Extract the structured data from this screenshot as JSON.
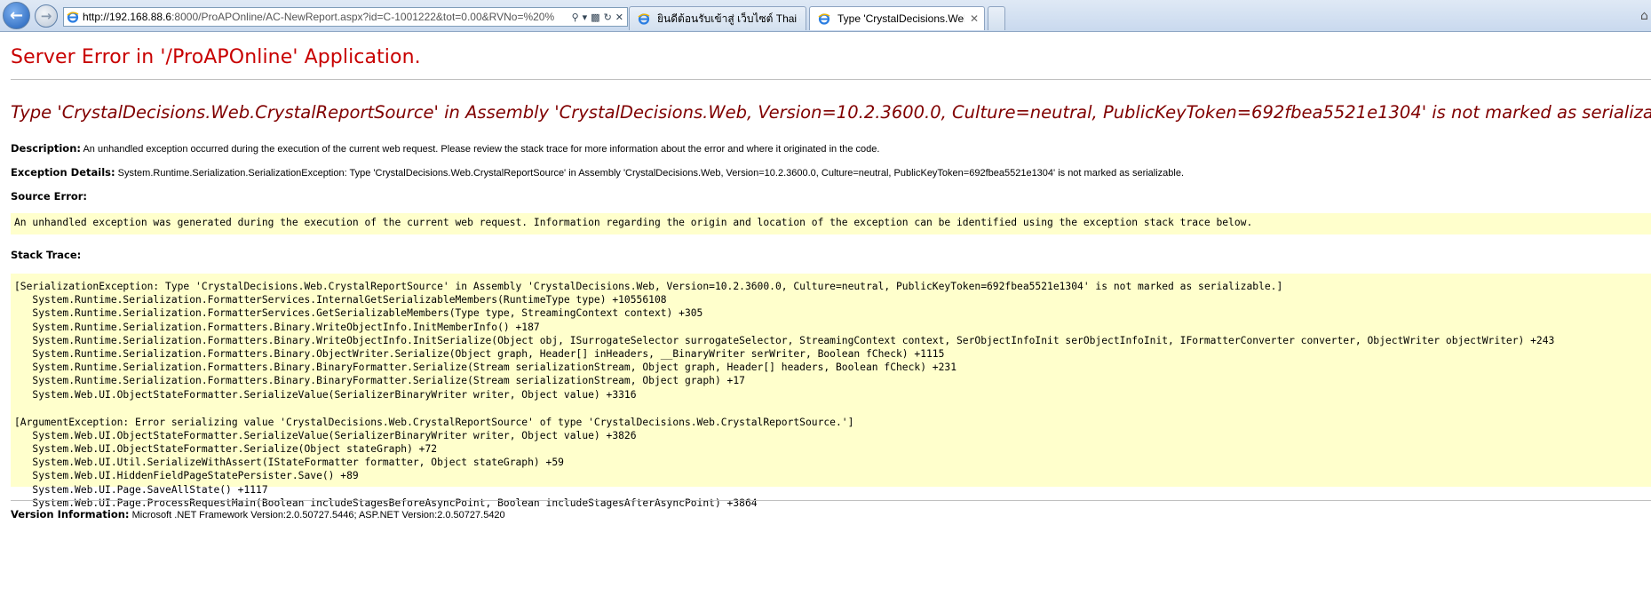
{
  "browser": {
    "url_host": "http://192.168.88.6",
    "url_rest": ":8000/ProAPOnline/AC-NewReport.aspx?id=C-1001222&tot=0.00&RVNo=%20%",
    "tabs": [
      {
        "label": "ยินดีต้อนรับเข้าสู่ เว็บไซต์ Thai - ..."
      },
      {
        "label": "Type 'CrystalDecisions.Web...",
        "close": "✕"
      }
    ]
  },
  "page": {
    "title": "Server Error in '/ProAPOnline' Application.",
    "error_type": "Type 'CrystalDecisions.Web.CrystalReportSource' in Assembly 'CrystalDecisions.Web, Version=10.2.3600.0, Culture=neutral, PublicKeyToken=692fbea5521e1304' is not marked as serializable.",
    "description_label": "Description:",
    "description": "An unhandled exception occurred during the execution of the current web request. Please review the stack trace for more information about the error and where it originated in the code.",
    "exception_label": "Exception Details:",
    "exception": "System.Runtime.Serialization.SerializationException: Type 'CrystalDecisions.Web.CrystalReportSource' in Assembly 'CrystalDecisions.Web, Version=10.2.3600.0, Culture=neutral, PublicKeyToken=692fbea5521e1304' is not marked as serializable.",
    "source_error_label": "Source Error:",
    "source_error": "An unhandled exception was generated during the execution of the current web request. Information regarding the origin and location of the exception can be identified using the exception stack trace below.",
    "stack_trace_label": "Stack Trace:",
    "stack_block1": [
      "[SerializationException: Type 'CrystalDecisions.Web.CrystalReportSource' in Assembly 'CrystalDecisions.Web, Version=10.2.3600.0, Culture=neutral, PublicKeyToken=692fbea5521e1304' is not marked as serializable.]",
      "   System.Runtime.Serialization.FormatterServices.InternalGetSerializableMembers(RuntimeType type) +10556108",
      "   System.Runtime.Serialization.FormatterServices.GetSerializableMembers(Type type, StreamingContext context) +305",
      "   System.Runtime.Serialization.Formatters.Binary.WriteObjectInfo.InitMemberInfo() +187",
      "   System.Runtime.Serialization.Formatters.Binary.WriteObjectInfo.InitSerialize(Object obj, ISurrogateSelector surrogateSelector, StreamingContext context, SerObjectInfoInit serObjectInfoInit, IFormatterConverter converter, ObjectWriter objectWriter) +243",
      "   System.Runtime.Serialization.Formatters.Binary.ObjectWriter.Serialize(Object graph, Header[] inHeaders, __BinaryWriter serWriter, Boolean fCheck) +1115",
      "   System.Runtime.Serialization.Formatters.Binary.BinaryFormatter.Serialize(Stream serializationStream, Object graph, Header[] headers, Boolean fCheck) +231",
      "   System.Runtime.Serialization.Formatters.Binary.BinaryFormatter.Serialize(Stream serializationStream, Object graph) +17",
      "   System.Web.UI.ObjectStateFormatter.SerializeValue(SerializerBinaryWriter writer, Object value) +3316"
    ],
    "stack_block2": [
      "[ArgumentException: Error serializing value 'CrystalDecisions.Web.CrystalReportSource' of type 'CrystalDecisions.Web.CrystalReportSource.']",
      "   System.Web.UI.ObjectStateFormatter.SerializeValue(SerializerBinaryWriter writer, Object value) +3826",
      "   System.Web.UI.ObjectStateFormatter.Serialize(Object stateGraph) +72",
      "   System.Web.UI.Util.SerializeWithAssert(IStateFormatter formatter, Object stateGraph) +59",
      "   System.Web.UI.HiddenFieldPageStatePersister.Save() +89",
      "   System.Web.UI.Page.SaveAllState() +1117",
      "   System.Web.UI.Page.ProcessRequestMain(Boolean includeStagesBeforeAsyncPoint, Boolean includeStagesAfterAsyncPoint) +3864"
    ],
    "version_label": "Version Information:",
    "version": "Microsoft .NET Framework Version:2.0.50727.5446; ASP.NET Version:2.0.50727.5420"
  },
  "colors": {
    "title": "#c80000",
    "error_type": "#800000",
    "code_background": "#ffffcc"
  }
}
